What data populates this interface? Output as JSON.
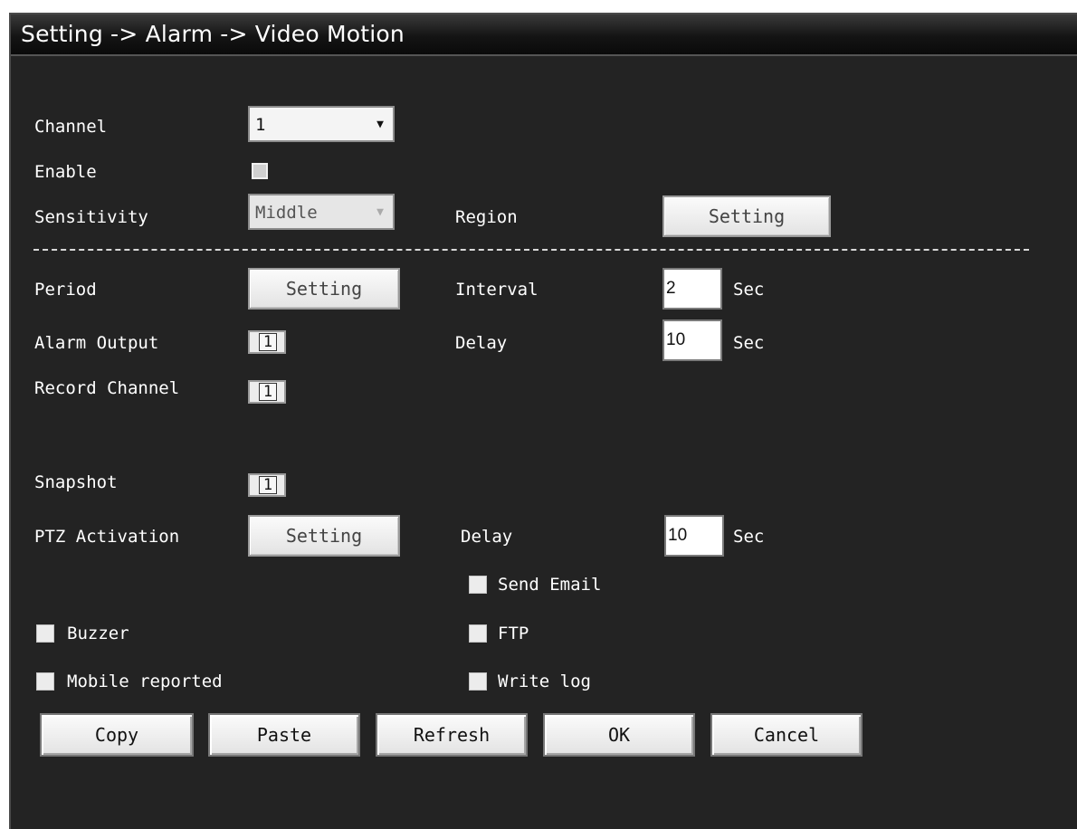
{
  "title": "Setting -> Alarm -> Video Motion",
  "channel": {
    "label": "Channel",
    "value": "1"
  },
  "enable": {
    "label": "Enable",
    "checked": false
  },
  "sensitivity": {
    "label": "Sensitivity",
    "value": "Middle"
  },
  "region": {
    "label": "Region",
    "button": "Setting"
  },
  "period": {
    "label": "Period",
    "button": "Setting"
  },
  "interval": {
    "label": "Interval",
    "value": "2",
    "unit": "Sec"
  },
  "alarm_output": {
    "label": "Alarm Output",
    "value": "1"
  },
  "output_delay": {
    "label": "Delay",
    "value": "10",
    "unit": "Sec"
  },
  "record_channel": {
    "label": "Record Channel",
    "value": "1"
  },
  "snapshot": {
    "label": "Snapshot",
    "value": "1"
  },
  "ptz": {
    "label": "PTZ Activation",
    "button": "Setting"
  },
  "ptz_delay": {
    "label": "Delay",
    "value": "10",
    "unit": "Sec"
  },
  "options": {
    "send_email": "Send Email",
    "buzzer": "Buzzer",
    "ftp": "FTP",
    "mobile_reported": "Mobile reported",
    "write_log": "Write log"
  },
  "buttons": {
    "copy": "Copy",
    "paste": "Paste",
    "refresh": "Refresh",
    "ok": "OK",
    "cancel": "Cancel"
  }
}
